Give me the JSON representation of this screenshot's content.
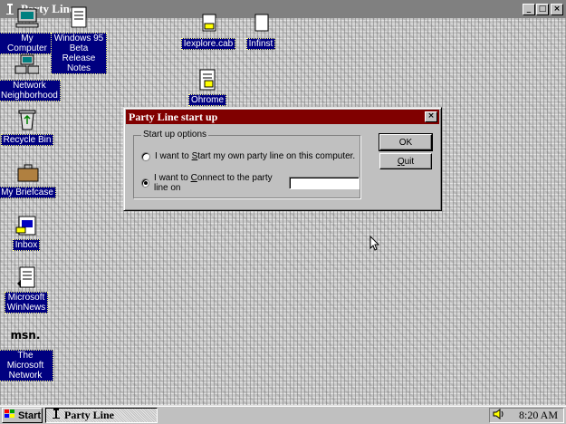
{
  "window": {
    "title": "Party Line",
    "minimize_glyph": "_",
    "maximize_glyph": "□",
    "close_glyph": "×"
  },
  "desktop_icons": [
    {
      "label": "My Computer",
      "icon": "computer-icon"
    },
    {
      "label": "Windows 95\nBeta Release\nNotes",
      "icon": "document-icon"
    },
    {
      "label": "Iexplore.cab",
      "icon": "cab-file-icon"
    },
    {
      "label": "Infinst",
      "icon": "file-icon"
    },
    {
      "label": "Ohrome",
      "icon": "notepad-icon"
    },
    {
      "label": "Network\nNeighborhood",
      "icon": "network-icon"
    },
    {
      "label": "Recycle Bin",
      "icon": "recycle-bin-icon"
    },
    {
      "label": "My Briefcase",
      "icon": "briefcase-icon"
    },
    {
      "label": "Inbox",
      "icon": "inbox-icon"
    },
    {
      "label": "Microsoft\nWinNews",
      "icon": "winnews-icon"
    },
    {
      "label": "The Microsoft\nNetwork",
      "icon": "msn-icon"
    }
  ],
  "dialog": {
    "title": "Party Line start up",
    "close_glyph": "×",
    "group_label": "Start up options",
    "option_start": {
      "pre": "I want to ",
      "key": "S",
      "post": "tart my own party line on this computer.",
      "checked": false
    },
    "option_connect": {
      "pre": "I want to ",
      "key": "C",
      "post": "onnect to the party line on",
      "checked": true
    },
    "party_input_value": "",
    "ok_label": "OK",
    "quit_key": "Q",
    "quit_rest": "uit"
  },
  "msn_logo": "msn.",
  "taskbar": {
    "start_label": "Start",
    "task_label": "Party Line",
    "clock": "8:20 AM"
  }
}
